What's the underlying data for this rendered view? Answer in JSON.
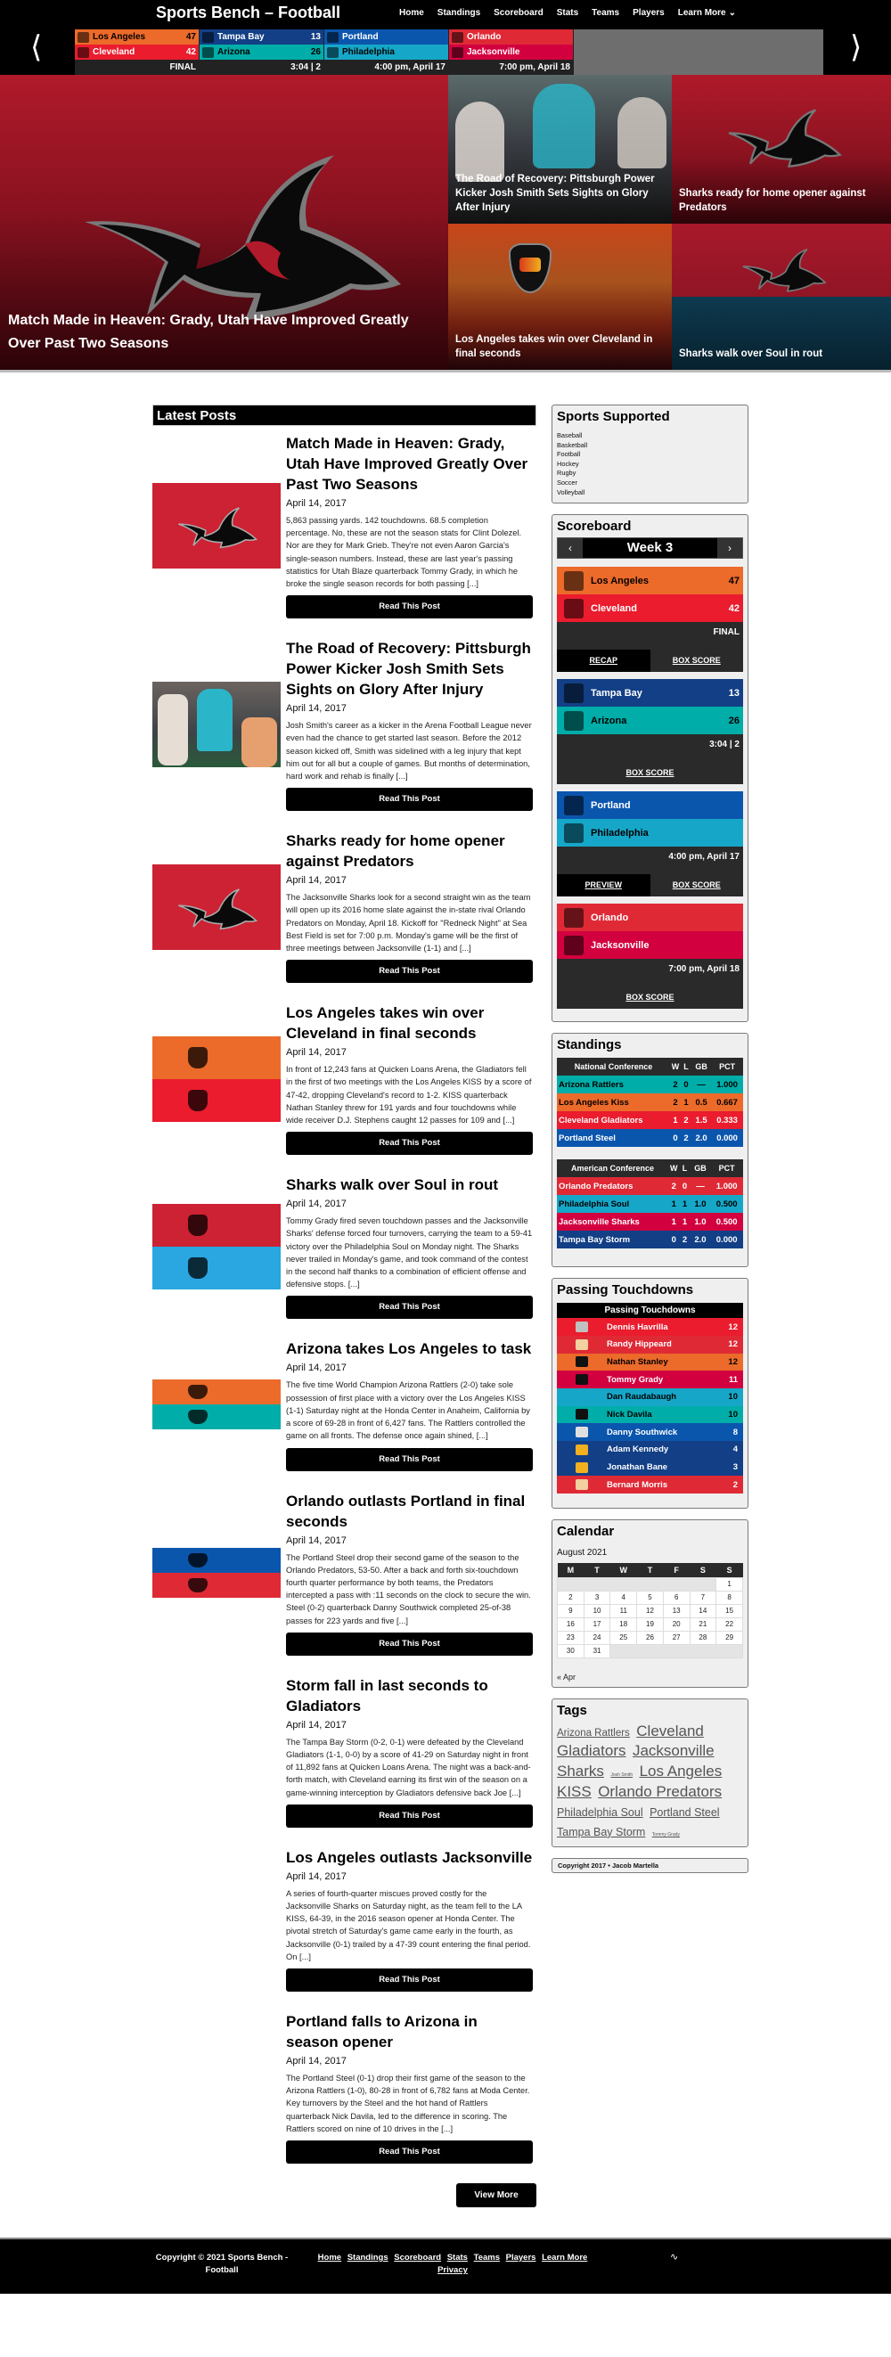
{
  "header": {
    "site_title": "Sports Bench – Football",
    "nav": [
      "Home",
      "Standings",
      "Scoreboard",
      "Stats",
      "Teams",
      "Players",
      "Learn More"
    ],
    "prev_icon": "chevron-left-icon",
    "next_icon": "chevron-right-icon"
  },
  "ticker": [
    {
      "away": {
        "name": "Los Angeles",
        "score": "47",
        "color": "#ec6a2a",
        "text": "dark"
      },
      "home": {
        "name": "Cleveland",
        "score": "42",
        "color": "#ea1c2e",
        "text": "light"
      },
      "status": "FINAL"
    },
    {
      "away": {
        "name": "Tampa Bay",
        "score": "13",
        "color": "#123f86",
        "text": "light"
      },
      "home": {
        "name": "Arizona",
        "score": "26",
        "color": "#00ada8",
        "text": "dark"
      },
      "status": "3:04 | 2"
    },
    {
      "away": {
        "name": "Portland",
        "score": "",
        "color": "#0b56ad",
        "text": "light"
      },
      "home": {
        "name": "Philadelphia",
        "score": "",
        "color": "#16a7c8",
        "text": "dark"
      },
      "status": "4:00 pm, April 17"
    },
    {
      "away": {
        "name": "Orlando",
        "score": "",
        "color": "#df2a36",
        "text": "light"
      },
      "home": {
        "name": "Jacksonville",
        "score": "",
        "color": "#d3003f",
        "text": "light"
      },
      "status": "7:00 pm, April 18"
    }
  ],
  "hero": {
    "main_title": "Match Made in Heaven: Grady, Utah Have Improved Greatly Over Past Two Seasons",
    "tiles": [
      "The Road of Recovery: Pittsburgh Power Kicker Josh Smith Sets Sights on Glory After Injury",
      "Sharks ready for home opener against Predators",
      "Los Angeles takes win over Cleveland in final seconds",
      "Sharks walk over Soul in rout"
    ]
  },
  "latest": {
    "heading": "Latest Posts",
    "read_label": "Read This Post",
    "view_more": "View More",
    "posts": [
      {
        "title": "Match Made in Heaven: Grady, Utah Have Improved Greatly Over Past Two Seasons",
        "date": "April 14, 2017",
        "excerpt": "5,863 passing yards. 142 touchdowns. 68.5 completion percentage. No, these are not the season stats for Clint Dolezel. Nor are they for Mark Grieb. They're not even Aaron Garcia's single-season numbers. Instead, these are last year's passing statistics for Utah Blaze quarterback Tommy Grady, in which he broke the single season records for both passing [...]",
        "thumb": "shark"
      },
      {
        "title": "The Road of Recovery: Pittsburgh Power Kicker Josh Smith Sets Sights on Glory After Injury",
        "date": "April 14, 2017",
        "excerpt": "Josh Smith's career as a kicker in the Arena Football League never even had the chance to get started last season. Before the 2012 season kicked off, Smith was sidelined with a leg injury that kept him out for all but a couple of games. But months of determination, hard work and rehab is finally [...]",
        "thumb": "photo"
      },
      {
        "title": "Sharks ready for home opener against Predators",
        "date": "April 14, 2017",
        "excerpt": "The Jacksonville Sharks look for a second straight win as the team will open up its 2016 home slate against the in-state rival Orlando Predators on Monday, April 18. Kickoff for \"Redneck Night\" at Sea Best Field is set for 7:00 p.m. Monday's game will be the first of three meetings between Jacksonville (1-1) and [...]",
        "thumb": "shark"
      },
      {
        "title": "Los Angeles takes win over Cleveland in final seconds",
        "date": "April 14, 2017",
        "excerpt": "In front of 12,243 fans at Quicken Loans Arena, the Gladiators fell in the first of two meetings with the Los Angeles KISS by a score of 47-42, dropping Cleveland's record to 1-2. KISS quarterback Nathan Stanley threw for 191 yards and four touchdowns while wide receiver D.J. Stephens caught 12 passes for 109 and [...]",
        "thumb": "split",
        "colors": [
          "#ec6a2a",
          "#ea1c2e"
        ]
      },
      {
        "title": "Sharks walk over Soul in rout",
        "date": "April 14, 2017",
        "excerpt": "Tommy Grady fired seven touchdown passes and the Jacksonville Sharks' defense forced four turnovers, carrying the team to a 59-41 victory over the Philadelphia Soul on Monday night. The Sharks never trailed in Monday's game, and took command of the contest in the second half thanks to a combination of efficient offense and defensive stops. [...]",
        "thumb": "split",
        "colors": [
          "#cc2233",
          "#2aa6e0"
        ]
      },
      {
        "title": "Arizona takes Los Angeles to task",
        "date": "April 14, 2017",
        "excerpt": "The five time World Champion Arizona Rattlers (2-0) take sole possession of first place with a victory over the Los Angeles KISS (1-1) Saturday night at the Honda Center in Anaheim, California by a score of 69-28 in front of 6,427 fans. The Rattlers controlled the game on all fronts. The defense once again shined, [...]",
        "thumb": "split-short",
        "colors": [
          "#ec6a2a",
          "#00ada8"
        ]
      },
      {
        "title": "Orlando outlasts Portland in final seconds",
        "date": "April 14, 2017",
        "excerpt": "The Portland Steel drop their second game of the season to the Orlando Predators, 53-50. After a back and forth six-touchdown fourth quarter performance by both teams, the Predators intercepted a pass with :11 seconds on the clock to secure the win. Steel (0-2) quarterback Danny Southwick completed 25-of-38 passes for 223 yards and five [...]",
        "thumb": "split-short",
        "colors": [
          "#0b56ad",
          "#df2a36"
        ]
      },
      {
        "title": "Storm fall in last seconds to Gladiators",
        "date": "April 14, 2017",
        "excerpt": "The Tampa Bay Storm (0-2, 0-1) were defeated by the Cleveland Gladiators (1-1, 0-0) by a score of 41-29 on Saturday night in front of 11,892 fans at Quicken Loans Arena. The night was a back-and-forth match, with Cleveland earning its first win of the season on a game-winning interception by Gladiators defensive back Joe [...]",
        "thumb": "none"
      },
      {
        "title": "Los Angeles outlasts Jacksonville",
        "date": "April 14, 2017",
        "excerpt": "A series of fourth-quarter miscues proved costly for the Jacksonville Sharks on Saturday night, as the team fell to the LA KISS, 64-39, in the 2016 season opener at Honda Center. The pivotal stretch of Saturday's game came early in the fourth, as Jacksonville (0-1) trailed by a 47-39 count entering the final period. On [...]",
        "thumb": "none"
      },
      {
        "title": "Portland falls to Arizona in season opener",
        "date": "April 14, 2017",
        "excerpt": "The Portland Steel (0-1) drop their first game of the season to the Arizona Rattlers (1-0), 80-28 in front of 6,782 fans at Moda Center. Key turnovers by the Steel and the hot hand of Rattlers quarterback Nick Davila, led to the difference in scoring. The Rattlers scored on nine of 10 drives in the [...]",
        "thumb": "none"
      }
    ]
  },
  "sidebar": {
    "sports": {
      "title": "Sports Supported",
      "items": [
        "Baseball",
        "Basketball",
        "Football",
        "Hockey",
        "Rugby",
        "Soccer",
        "Volleyball"
      ]
    },
    "scoreboard": {
      "title": "Scoreboard",
      "week": "Week 3",
      "recap": "RECAP",
      "preview": "PREVIEW",
      "box_score": "BOX SCORE",
      "games": [
        {
          "away": {
            "name": "Los Angeles",
            "score": "47",
            "color": "#ec6a2a",
            "text": "dark"
          },
          "home": {
            "name": "Cleveland",
            "score": "42",
            "color": "#ea1c2e",
            "text": "light"
          },
          "status": "FINAL",
          "first_link": "recap"
        },
        {
          "away": {
            "name": "Tampa Bay",
            "score": "13",
            "color": "#123f86",
            "text": "light"
          },
          "home": {
            "name": "Arizona",
            "score": "26",
            "color": "#00ada8",
            "text": "dark"
          },
          "status": "3:04 | 2",
          "first_link": ""
        },
        {
          "away": {
            "name": "Portland",
            "score": "",
            "color": "#0b56ad",
            "text": "light"
          },
          "home": {
            "name": "Philadelphia",
            "score": "",
            "color": "#16a7c8",
            "text": "dark"
          },
          "status": "4:00 pm, April 17",
          "first_link": "preview"
        },
        {
          "away": {
            "name": "Orlando",
            "score": "",
            "color": "#df2a36",
            "text": "light"
          },
          "home": {
            "name": "Jacksonville",
            "score": "",
            "color": "#d3003f",
            "text": "light"
          },
          "status": "7:00 pm, April 18",
          "first_link": ""
        }
      ]
    },
    "standings": {
      "title": "Standings",
      "columns": [
        "W",
        "L",
        "GB",
        "PCT"
      ],
      "conferences": [
        {
          "name": "National Conference",
          "rows": [
            {
              "team": "Arizona Rattlers",
              "w": "2",
              "l": "0",
              "gb": "—",
              "pct": "1.000",
              "color": "#00ada8",
              "text": "dark"
            },
            {
              "team": "Los Angeles Kiss",
              "w": "2",
              "l": "1",
              "gb": "0.5",
              "pct": "0.667",
              "color": "#ec6a2a",
              "text": "dark"
            },
            {
              "team": "Cleveland Gladiators",
              "w": "1",
              "l": "2",
              "gb": "1.5",
              "pct": "0.333",
              "color": "#ea1c2e",
              "text": "light"
            },
            {
              "team": "Portland Steel",
              "w": "0",
              "l": "2",
              "gb": "2.0",
              "pct": "0.000",
              "color": "#0b56ad",
              "text": "light"
            }
          ]
        },
        {
          "name": "American Conference",
          "rows": [
            {
              "team": "Orlando Predators",
              "w": "2",
              "l": "0",
              "gb": "—",
              "pct": "1.000",
              "color": "#df2a36",
              "text": "light"
            },
            {
              "team": "Philadelphia Soul",
              "w": "1",
              "l": "1",
              "gb": "1.0",
              "pct": "0.500",
              "color": "#16a7c8",
              "text": "dark"
            },
            {
              "team": "Jacksonville Sharks",
              "w": "1",
              "l": "1",
              "gb": "1.0",
              "pct": "0.500",
              "color": "#d3003f",
              "text": "light"
            },
            {
              "team": "Tampa Bay Storm",
              "w": "0",
              "l": "2",
              "gb": "2.0",
              "pct": "0.000",
              "color": "#123f86",
              "text": "light"
            }
          ]
        }
      ]
    },
    "passing": {
      "title": "Passing Touchdowns",
      "table_head": "Passing Touchdowns",
      "rows": [
        {
          "player": "Dennis Havrilla",
          "value": "12",
          "color": "#ea1c2e",
          "text": "light",
          "logo": "#c0c0c0"
        },
        {
          "player": "Randy Hippeard",
          "value": "12",
          "color": "#df2a36",
          "text": "light",
          "logo": "#f2d0a0"
        },
        {
          "player": "Nathan Stanley",
          "value": "12",
          "color": "#ec6a2a",
          "text": "dark",
          "logo": "#111111"
        },
        {
          "player": "Tommy Grady",
          "value": "11",
          "color": "#d3003f",
          "text": "light",
          "logo": "#111111"
        },
        {
          "player": "Dan Raudabaugh",
          "value": "10",
          "color": "#16a7c8",
          "text": "dark",
          "logo": "#16a7c8"
        },
        {
          "player": "Nick Davila",
          "value": "10",
          "color": "#00ada8",
          "text": "dark",
          "logo": "#111111"
        },
        {
          "player": "Danny Southwick",
          "value": "8",
          "color": "#0b56ad",
          "text": "light",
          "logo": "#e0e0e0"
        },
        {
          "player": "Adam Kennedy",
          "value": "4",
          "color": "#123f86",
          "text": "light",
          "logo": "#f0b020"
        },
        {
          "player": "Jonathan Bane",
          "value": "3",
          "color": "#123f86",
          "text": "light",
          "logo": "#f0b020"
        },
        {
          "player": "Bernard Morris",
          "value": "2",
          "color": "#df2a36",
          "text": "light",
          "logo": "#f2d0a0"
        }
      ]
    },
    "calendar": {
      "title": "Calendar",
      "caption": "August 2021",
      "days": [
        "M",
        "T",
        "W",
        "T",
        "F",
        "S",
        "S"
      ],
      "weeks": [
        [
          "",
          "",
          "",
          "",
          "",
          "",
          "1"
        ],
        [
          "2",
          "3",
          "4",
          "5",
          "6",
          "7",
          "8"
        ],
        [
          "9",
          "10",
          "11",
          "12",
          "13",
          "14",
          "15"
        ],
        [
          "16",
          "17",
          "18",
          "19",
          "20",
          "21",
          "22"
        ],
        [
          "23",
          "24",
          "25",
          "26",
          "27",
          "28",
          "29"
        ],
        [
          "30",
          "31",
          "",
          "",
          "",
          "",
          ""
        ]
      ],
      "prev": "« Apr"
    },
    "tags": {
      "title": "Tags",
      "items": [
        {
          "label": "Arizona Rattlers",
          "weight": 2
        },
        {
          "label": "Cleveland Gladiators",
          "weight": 4
        },
        {
          "label": "Jacksonville Sharks",
          "weight": 4
        },
        {
          "label": "Josh Smith",
          "weight": 0
        },
        {
          "label": "Los Angeles KISS",
          "weight": 4
        },
        {
          "label": "Orlando Predators",
          "weight": 4
        },
        {
          "label": "Philadelphia Soul",
          "weight": 3
        },
        {
          "label": "Portland Steel",
          "weight": 3
        },
        {
          "label": "Tampa Bay Storm",
          "weight": 3
        },
        {
          "label": "Tommy Grady",
          "weight": 0
        }
      ]
    },
    "copyright": "Copyright 2017 • Jacob Martella"
  },
  "footer": {
    "copyright": "Copyright © 2021 Sports Bench - Football",
    "nav": [
      "Home",
      "Standings",
      "Scoreboard",
      "Stats",
      "Teams",
      "Players",
      "Learn More",
      "Privacy"
    ],
    "rss_icon": "rss-icon"
  }
}
